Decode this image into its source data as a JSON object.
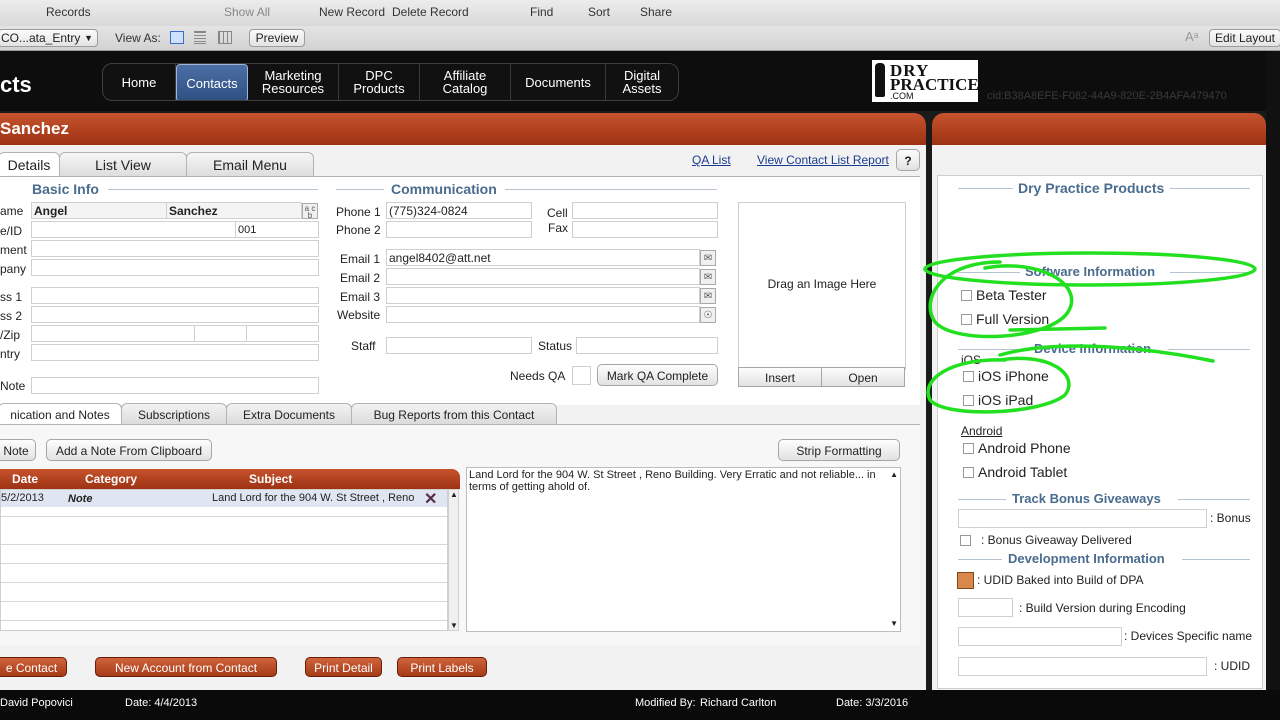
{
  "toolbar": {
    "records": "Records",
    "show_all": "Show All",
    "new_record": "New Record",
    "delete_record": "Delete Record",
    "find": "Find",
    "sort": "Sort",
    "share": "Share",
    "layout_select": "CO...ata_Entry",
    "view_as": "View As:",
    "preview": "Preview",
    "edit_layout": "Edit Layout"
  },
  "header": {
    "app_title": "cts",
    "nav": [
      "Home",
      "Contacts",
      "Marketing Resources",
      "DPC Products",
      "Affiliate Catalog",
      "Documents",
      "Digital Assets"
    ],
    "active_nav": "Contacts",
    "logo_line1": "DRY",
    "logo_line2": "PRACTICE",
    "logo_line3": ".COM",
    "cid": "cid:B38A8EFE-F082-44A9-820E-2B4AFA479470"
  },
  "record": {
    "name": "Sanchez"
  },
  "tabs": {
    "details": "Details",
    "list_view": "List View",
    "email_menu": "Email Menu",
    "qa_list": "QA List",
    "view_contact_list_report": "View Contact List Report",
    "help": "?"
  },
  "basic_info": {
    "title": "Basic Info",
    "labels": [
      "ame",
      "e/ID",
      "ment",
      "pany",
      "ss 1",
      "ss 2",
      "/Zip",
      "ntry",
      "Note"
    ],
    "first_name": "Angel",
    "last_name": "Sanchez",
    "id_value": "001",
    "abc_icon": "a c b"
  },
  "communication": {
    "title": "Communication",
    "phone1_label": "Phone 1",
    "phone1": "(775)324-0824",
    "phone2_label": "Phone 2",
    "cell_label": "Cell",
    "fax_label": "Fax",
    "email1_label": "Email 1",
    "email1": "angel8402@att.net",
    "email2_label": "Email 2",
    "email3_label": "Email 3",
    "website_label": "Website",
    "staff_label": "Staff",
    "status_label": "Status",
    "needs_qa_label": "Needs QA",
    "mark_qa": "Mark QA Complete"
  },
  "image": {
    "drag_text": "Drag an Image Here",
    "insert": "Insert",
    "open": "Open"
  },
  "bottom_tabs": [
    "nication and Notes",
    "Subscriptions",
    "Extra Documents",
    "Bug Reports from this Contact"
  ],
  "notes": {
    "new_note": "Note",
    "add_from_clipboard": "Add a Note From Clipboard",
    "strip_formatting": "Strip Formatting",
    "col_date": "Date",
    "col_category": "Category",
    "col_subject": "Subject",
    "row_date": "5/2/2013",
    "row_category": "Note",
    "row_subject": "Land Lord for the 904 W. St Street , Reno",
    "note_text": "Land Lord for the 904 W. St Street , Reno Building.   Very Erratic and not reliable... in terms of getting ahold of."
  },
  "actions": {
    "delete_contact": "e Contact",
    "new_account": "New Account from Contact",
    "print_detail": "Print Detail",
    "print_labels": "Print Labels"
  },
  "status": {
    "created_by": "David Popovici",
    "created_date": "Date: 4/4/2013",
    "modified_by_label": "Modified By:",
    "modified_by": "Richard Carlton",
    "modified_date": "Date: 3/3/2016"
  },
  "right": {
    "products_title": "Dry Practice Products",
    "software_title": "Software Information",
    "beta_tester": "Beta Tester",
    "full_version": "Full Version",
    "device_title": "Device Information",
    "ios_label": "iOS",
    "ios_iphone": "iOS iPhone",
    "ios_ipad": "iOS iPad",
    "android_label": "Android",
    "android_phone": "Android Phone",
    "android_tablet": "Android Tablet",
    "bonus_title": "Track Bonus Giveaways",
    "bonus_label": ": Bonus",
    "bonus_delivered": ": Bonus Giveaway Delivered",
    "dev_title": "Development Information",
    "udid_baked": ": UDID Baked into Build of DPA",
    "build_version": ": Build Version during Encoding",
    "devices_specific": ": Devices Specific name",
    "udid": ": UDID"
  },
  "colors": {
    "accent_red": "#b5431f",
    "nav_active": "#3b5e95",
    "section_blue": "#4a6c8e",
    "annotation_green": "#22e01f"
  }
}
